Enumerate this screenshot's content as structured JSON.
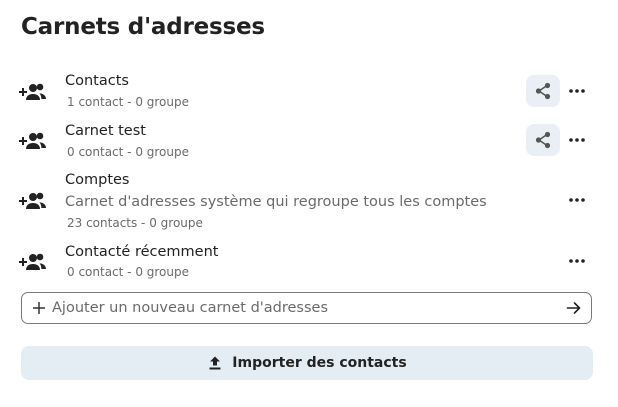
{
  "title": "Carnets d'adresses",
  "icons": {
    "book": "account-multiple-plus-icon",
    "share": "share-variant-icon",
    "more": "dots-horizontal-icon",
    "plus": "plus-icon",
    "submit": "arrow-right-icon",
    "import": "upload-icon"
  },
  "colors": {
    "accent_bg": "#e9eff4",
    "import_bg": "#e4edf4",
    "text": "#222222",
    "muted": "#6b6b6b",
    "border": "#7a7a7a"
  },
  "address_books": [
    {
      "name": "Contacts",
      "description": "",
      "meta": "1 contact  - 0 groupe",
      "shareable": true
    },
    {
      "name": "Carnet test",
      "description": "",
      "meta": "0 contact  - 0 groupe",
      "shareable": true
    },
    {
      "name": "Comptes",
      "description": "Carnet d'adresses système qui regroupe tous les comptes",
      "meta": "23 contacts  - 0 groupe",
      "shareable": false
    },
    {
      "name": "Contacté récemment",
      "description": "",
      "meta": "0 contact  - 0 groupe",
      "shareable": false
    }
  ],
  "add_book": {
    "placeholder": "Ajouter un nouveau carnet d'adresses",
    "value": ""
  },
  "import": {
    "label": "Importer des contacts"
  }
}
